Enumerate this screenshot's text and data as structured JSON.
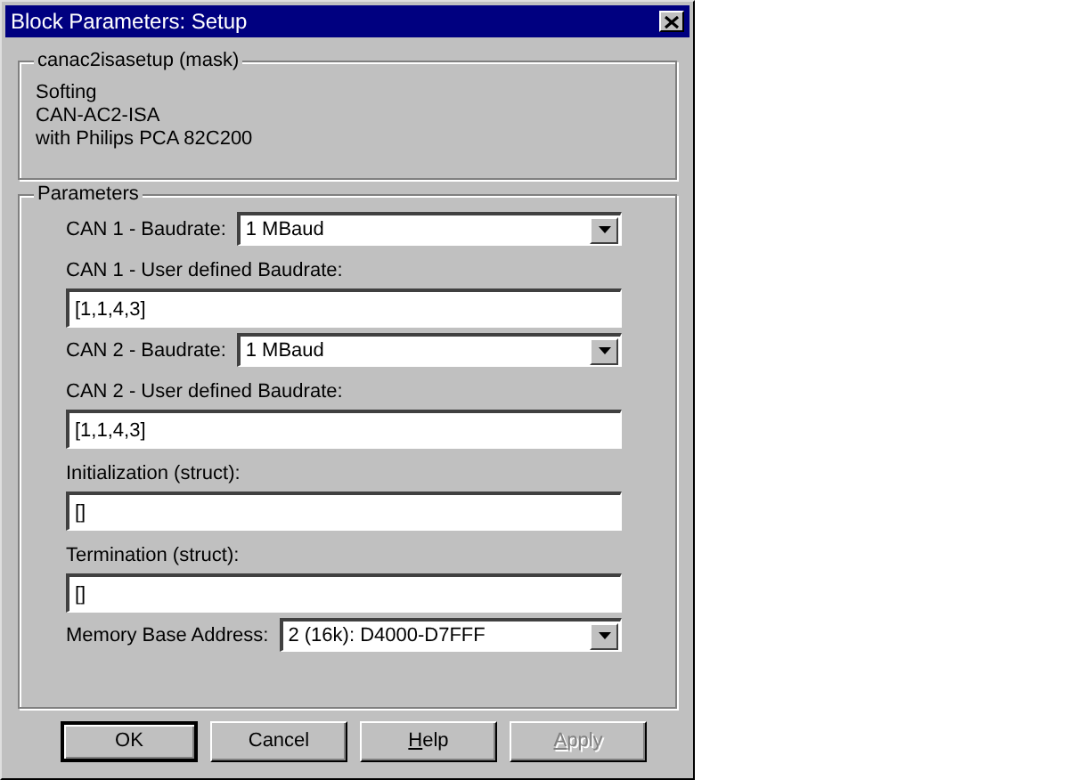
{
  "window": {
    "title": "Block Parameters: Setup"
  },
  "mask_group": {
    "title": "canac2isasetup (mask)",
    "lines": [
      "Softing",
      "CAN-AC2-ISA",
      "with Philips PCA 82C200"
    ]
  },
  "parameters": {
    "title": "Parameters",
    "items": [
      {
        "kind": "dropdown",
        "label": "CAN 1 - Baudrate:",
        "value": "1 MBaud"
      },
      {
        "kind": "text",
        "label": "CAN 1 - User defined Baudrate:",
        "value": "[1,1,4,3]"
      },
      {
        "kind": "dropdown",
        "label": "CAN 2 - Baudrate:",
        "value": "1 MBaud"
      },
      {
        "kind": "text",
        "label": "CAN 2 - User defined Baudrate:",
        "value": "[1,1,4,3]"
      },
      {
        "kind": "text",
        "label": "Initialization (struct):",
        "value": "[]"
      },
      {
        "kind": "text",
        "label": "Termination (struct):",
        "value": "[]"
      },
      {
        "kind": "dropdown",
        "label": "Memory Base Address:",
        "value": "2 (16k): D4000-D7FFF"
      }
    ]
  },
  "buttons": [
    {
      "label": "OK",
      "default": true,
      "disabled": false,
      "underline_first": false
    },
    {
      "label": "Cancel",
      "default": false,
      "disabled": false,
      "underline_first": false
    },
    {
      "label": "Help",
      "default": false,
      "disabled": false,
      "underline_first": true
    },
    {
      "label": "Apply",
      "default": false,
      "disabled": true,
      "underline_first": true
    }
  ]
}
